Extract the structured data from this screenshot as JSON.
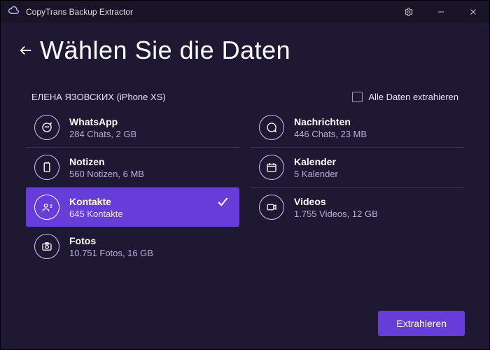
{
  "titlebar": {
    "app_name": "CopyTrans Backup Extractor"
  },
  "header": {
    "title": "Wählen Sie die Daten"
  },
  "device_line": "ЕЛЕНА ЯЗОВСКИХ (iPhone XS)",
  "extract_all_label": "Alle Daten extrahieren",
  "left_items": [
    {
      "label": "WhatsApp",
      "sub": "284 Chats, 2 GB",
      "selected": false
    },
    {
      "label": "Notizen",
      "sub": "560 Notizen, 6 MB",
      "selected": false
    },
    {
      "label": "Kontakte",
      "sub": "645 Kontakte",
      "selected": true
    },
    {
      "label": "Fotos",
      "sub": "10.751 Fotos, 16 GB",
      "selected": false
    }
  ],
  "right_items": [
    {
      "label": "Nachrichten",
      "sub": "446 Chats, 23 MB",
      "selected": false
    },
    {
      "label": "Kalender",
      "sub": "5 Kalender",
      "selected": false
    },
    {
      "label": "Videos",
      "sub": "1.755 Videos, 12 GB",
      "selected": false
    }
  ],
  "footer": {
    "extract_label": "Extrahieren"
  }
}
